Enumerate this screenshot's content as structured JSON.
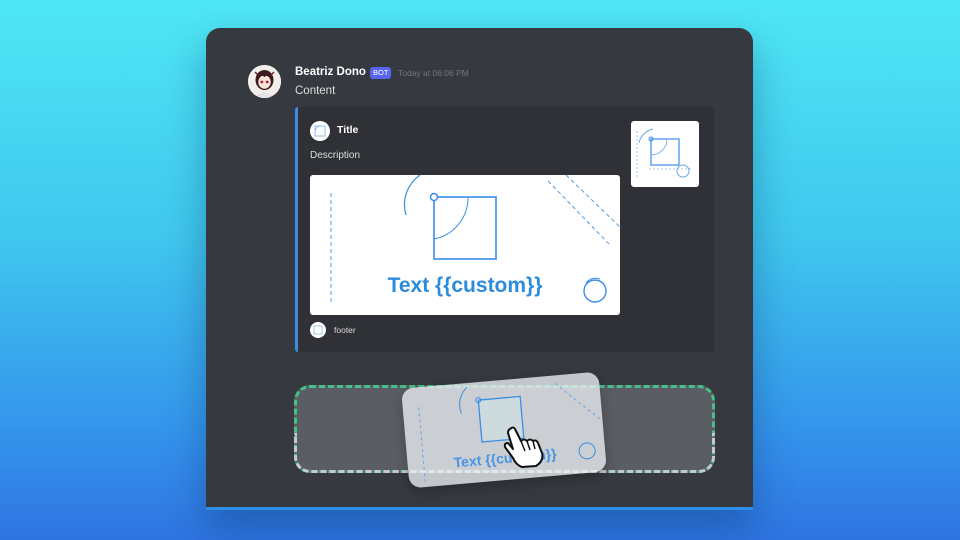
{
  "message": {
    "author": "Beatriz Dono",
    "badge": "BOT",
    "timestamp": "Today at 06:06 PM",
    "content": "Content"
  },
  "embed": {
    "accent_color": "#3a8ee6",
    "title": "Title",
    "description": "Description",
    "image_text": "Text {{custom}}",
    "footer": "footer"
  },
  "drag_preview": {
    "text": "Text {{custom}}"
  },
  "icons": {
    "avatar": "anime-girl-avatar",
    "author_icon": "blueprint-icon",
    "footer_icon": "blueprint-icon",
    "cursor": "hand-pointer-icon"
  },
  "colors": {
    "bot_badge": "#5865f2",
    "drop_zone_border": "#45c08a"
  }
}
